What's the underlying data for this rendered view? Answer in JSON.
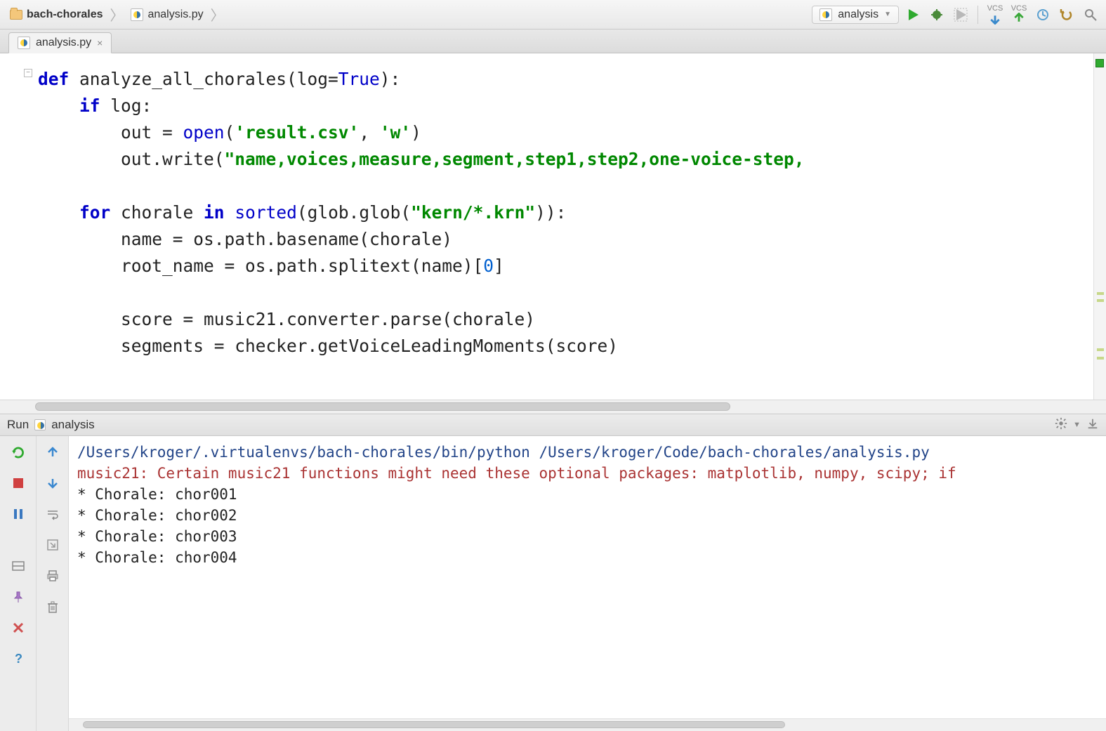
{
  "breadcrumb": {
    "project": "bach-chorales",
    "file": "analysis.py"
  },
  "run_config": {
    "label": "analysis"
  },
  "tab": {
    "label": "analysis.py"
  },
  "code": {
    "l1a": "def",
    "l1b": " analyze_all_chorales(log=",
    "l1c": "True",
    "l1d": "):",
    "l2a": "    ",
    "l2b": "if",
    "l2c": " log:",
    "l3a": "        out = ",
    "l3b": "open",
    "l3c": "(",
    "l3d": "'result.csv'",
    "l3e": ", ",
    "l3f": "'w'",
    "l3g": ")",
    "l4a": "        out.write(",
    "l4b": "\"name,voices,measure,segment,step1,step2,one-voice-step,",
    "l5": "",
    "l6a": "    ",
    "l6b": "for",
    "l6c": " chorale ",
    "l6d": "in",
    "l6e": " ",
    "l6f": "sorted",
    "l6g": "(glob.glob(",
    "l6h": "\"kern/*.krn\"",
    "l6i": ")):",
    "l7a": "        name = os.path.basename(chorale)",
    "l8a": "        root_name = os.path.splitext(name)[",
    "l8b": "0",
    "l8c": "]",
    "l9": "",
    "l10": "        score = music21.converter.parse(chorale)",
    "l11": "        segments = checker.getVoiceLeadingMoments(score)"
  },
  "run_panel": {
    "title_prefix": "Run",
    "title": "analysis",
    "cmd": "/Users/kroger/.virtualenvs/bach-chorales/bin/python /Users/kroger/Code/bach-chorales/analysis.py",
    "warn": "music21: Certain music21 functions might need these optional packages: matplotlib, numpy, scipy; if",
    "lines": [
      "* Chorale:  chor001",
      "* Chorale:  chor002",
      "* Chorale:  chor003",
      "* Chorale:  chor004"
    ]
  }
}
